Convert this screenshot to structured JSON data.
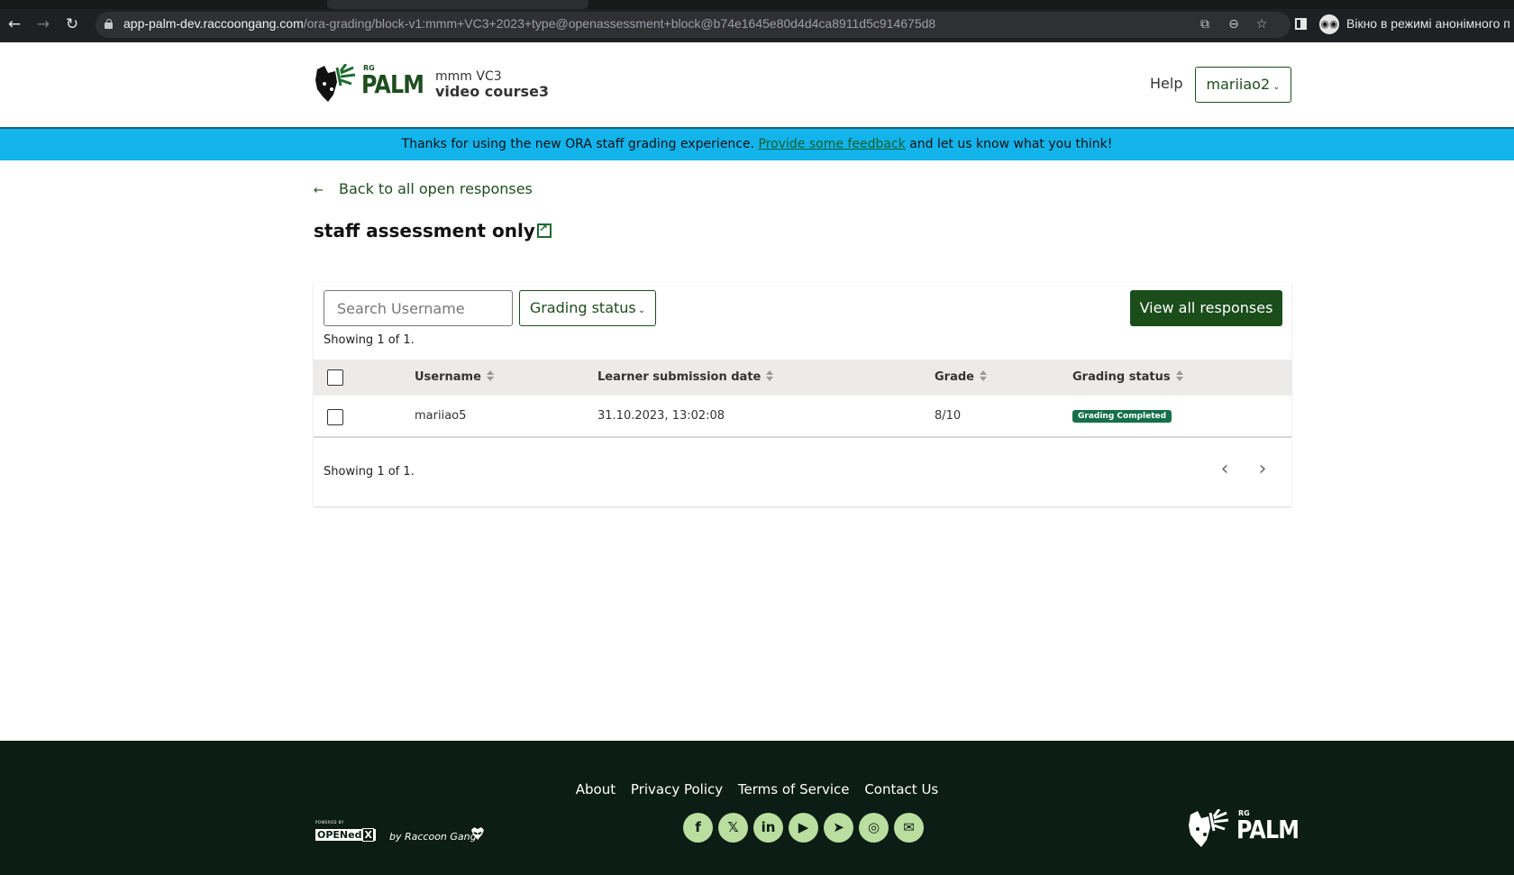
{
  "browser": {
    "url_host": "app-palm-dev.raccoongang.com",
    "url_path": "/ora-grading/block-v1:mmm+VC3+2023+type@openassessment+block@b74e1645e80d4d4ca8911d5c914675d8",
    "incognito_label": "Вікно в режимі анонімного п",
    "icons": [
      "back-arrow-icon",
      "forward-arrow-icon",
      "reload-icon",
      "lock-icon",
      "translate-icon",
      "zoom-out-icon",
      "star-icon",
      "side-panel-icon",
      "incognito-icon"
    ]
  },
  "header": {
    "logo_rg": "RG",
    "logo_text": "PALM",
    "course_org": "mmm VC3",
    "course_name": "video course3",
    "help_label": "Help",
    "username": "mariiao2"
  },
  "banner": {
    "text_before": "Thanks for using the new ORA staff grading experience. ",
    "link_text": "Provide some feedback",
    "text_after": " and let us know what you think!"
  },
  "page": {
    "back_label": "Back to all open responses",
    "title": "staff assessment only"
  },
  "toolbar": {
    "search_placeholder": "Search Username",
    "search_value": "",
    "status_filter_label": "Grading status",
    "view_all_label": "View all responses"
  },
  "table": {
    "showing_top": "Showing 1 of 1.",
    "showing_bottom": "Showing 1 of 1.",
    "columns": [
      "Username",
      "Learner submission date",
      "Grade",
      "Grading status"
    ],
    "rows": [
      {
        "username": "mariiao5",
        "submission_date": "31.10.2023, 13:02:08",
        "grade": "8/10",
        "status": "Grading Completed",
        "selected": false
      }
    ],
    "status_badge_color": "#15704a"
  },
  "footer": {
    "links": [
      "About",
      "Privacy Policy",
      "Terms of Service",
      "Contact Us"
    ],
    "social": [
      {
        "name": "facebook-icon",
        "glyph": "f"
      },
      {
        "name": "x-twitter-icon",
        "glyph": "𝕏"
      },
      {
        "name": "linkedin-icon",
        "glyph": "in"
      },
      {
        "name": "youtube-icon",
        "glyph": "▶"
      },
      {
        "name": "telegram-icon",
        "glyph": "➤"
      },
      {
        "name": "instagram-icon",
        "glyph": "◎"
      },
      {
        "name": "email-icon",
        "glyph": "✉"
      }
    ],
    "powered_by": "POWERED BY",
    "openedx_open": "OPEN",
    "openedx_ed": "ed",
    "openedx_x": "X",
    "by_raccoon_gang": "by Raccoon Gang",
    "logo_rg": "RG",
    "logo_text": "PALM"
  },
  "colors": {
    "brand_green": "#1e4d1e",
    "banner_blue": "#13b3ec",
    "footer_bg": "#0b1d14",
    "social_bg": "#b9de9f"
  }
}
